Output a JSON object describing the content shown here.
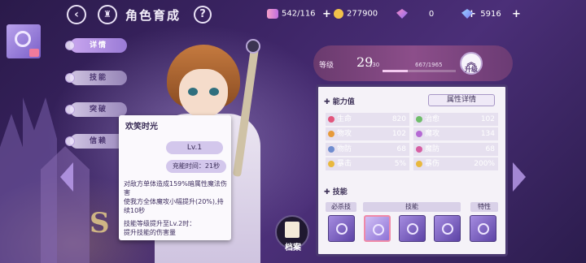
{
  "header": {
    "title": "角色育成",
    "resources": [
      {
        "name": "candy",
        "value": "542/116"
      },
      {
        "name": "gold",
        "value": "277900"
      },
      {
        "name": "pink-gem",
        "value": "0"
      },
      {
        "name": "blue-gem",
        "value": "5916"
      }
    ],
    "plus": "+",
    "back_icon": "‹",
    "help_icon": "?"
  },
  "tabs": [
    {
      "label": "详情",
      "active": true
    },
    {
      "label": "技能",
      "active": false
    },
    {
      "label": "突破",
      "active": false
    },
    {
      "label": "信赖",
      "active": false
    }
  ],
  "tooltip": {
    "name": "欢笑时光",
    "level": "Lv.1",
    "energy": "充能时间：21秒",
    "description": "对敌方单体造成159%暗属性魔法伤害\n使我方全体魔攻小幅提升(20%),持续10秒",
    "upgrade": "技能等级提升至Lv.2时：\n提升技能的伤害量"
  },
  "level": {
    "label": "等级",
    "value": "29",
    "max": "/30",
    "exp": "667/1965",
    "exp_fraction": 0.34,
    "upgrade_label": "升级"
  },
  "stats": {
    "title": "能力值",
    "detail_button": "属性详情",
    "left": [
      {
        "label": "生命",
        "value": "820",
        "color": "#e2557c"
      },
      {
        "label": "物攻",
        "value": "102",
        "color": "#e79a3a"
      },
      {
        "label": "物防",
        "value": "68",
        "color": "#6f8ccf"
      },
      {
        "label": "暴击",
        "value": "5%",
        "color": "#e9b83d"
      }
    ],
    "right": [
      {
        "label": "治愈",
        "value": "102",
        "color": "#6fbd6a"
      },
      {
        "label": "魔攻",
        "value": "134",
        "color": "#b56ad4"
      },
      {
        "label": "魔防",
        "value": "68",
        "color": "#d65fa3"
      },
      {
        "label": "暴伤",
        "value": "200%",
        "color": "#e9b83d"
      }
    ]
  },
  "skills": {
    "title": "技能",
    "tags": [
      "必杀技",
      "技能",
      "特性"
    ]
  },
  "archive_label": "档案",
  "deco_letter": "S"
}
